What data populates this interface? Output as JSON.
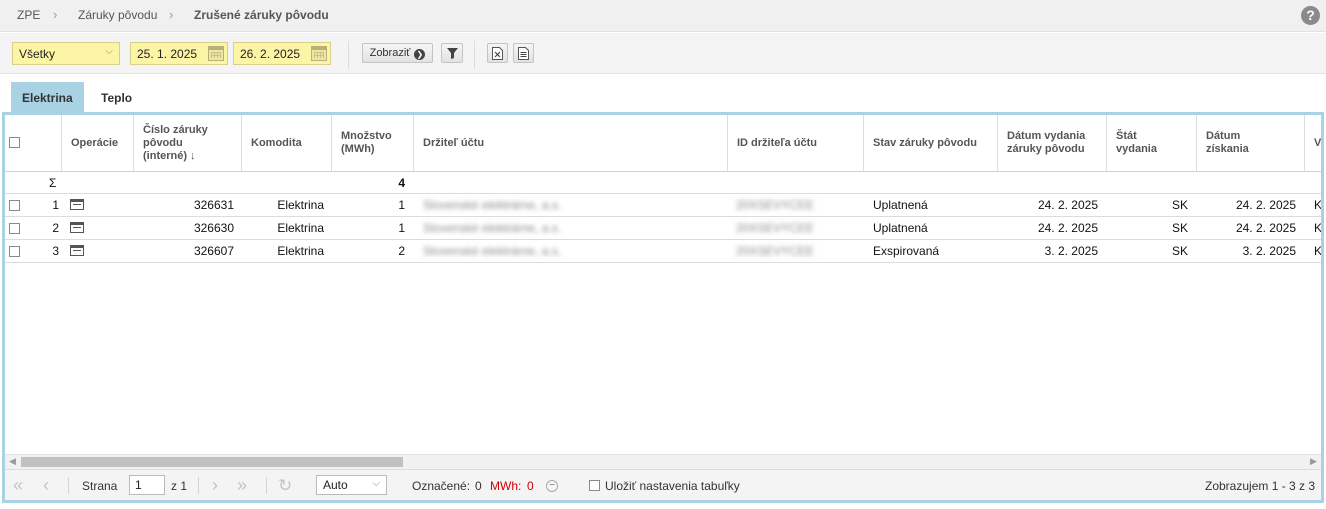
{
  "breadcrumb": {
    "items": [
      "ZPE",
      "Záruky pôvodu"
    ],
    "current": "Zrušené záruky pôvodu",
    "sep": "›"
  },
  "help": {
    "glyph": "?"
  },
  "toolbar": {
    "filter_select": "Všetky",
    "date_from": "25. 1. 2025",
    "date_to": "26. 2. 2025",
    "show_button": "Zobraziť"
  },
  "tabs": [
    {
      "label": "Elektrina",
      "active": true
    },
    {
      "label": "Teplo",
      "active": false
    }
  ],
  "columns": {
    "operations": "Operácie",
    "number": "Číslo záruky pôvodu (interné) ↓",
    "commodity": "Komodita",
    "amount": "Množstvo (MWh)",
    "holder": "Držiteľ účtu",
    "holder_id": "ID držiteľa účtu",
    "state": "Stav záruky pôvodu",
    "issue_date": "Dátum vydania záruky pôvodu",
    "issue_state": "Štát vydania",
    "acquired": "Dátum získania",
    "next": "Vy"
  },
  "sum_row": {
    "symbol": "Σ",
    "amount_total": "4"
  },
  "rows": [
    {
      "index": "1",
      "number": "326631",
      "commodity": "Elektrina",
      "amount": "1",
      "holder": "Slovenské elektrárne, a.s.",
      "holder_id": "20XSEVYCEE",
      "state": "Uplatnená",
      "issue_date": "24. 2. 2025",
      "issue_state": "SK",
      "acquired": "24. 2. 2025",
      "next": "K"
    },
    {
      "index": "2",
      "number": "326630",
      "commodity": "Elektrina",
      "amount": "1",
      "holder": "Slovenské elektrárne, a.s.",
      "holder_id": "20XSEVYCEE",
      "state": "Uplatnená",
      "issue_date": "24. 2. 2025",
      "issue_state": "SK",
      "acquired": "24. 2. 2025",
      "next": "K"
    },
    {
      "index": "3",
      "number": "326607",
      "commodity": "Elektrina",
      "amount": "2",
      "holder": "Slovenské elektrárne, a.s.",
      "holder_id": "20XSEVYCEE",
      "state": "Exspirovaná",
      "issue_date": "3. 2. 2025",
      "issue_state": "SK",
      "acquired": "3. 2. 2025",
      "next": "K"
    }
  ],
  "pager": {
    "page_label": "Strana",
    "page_value": "1",
    "of_label": "z 1",
    "page_size": "Auto",
    "marked_label": "Označené:",
    "marked_value": "0",
    "mwh_label": "MWh:",
    "mwh_value": "0",
    "save_settings": "Uložiť nastavenia tabuľky",
    "summary": "Zobrazujem 1 - 3 z 3"
  },
  "colors": {
    "accent": "#a9d3e5",
    "input_bg": "#fdf5a6",
    "mwh_red": "#d10000"
  }
}
